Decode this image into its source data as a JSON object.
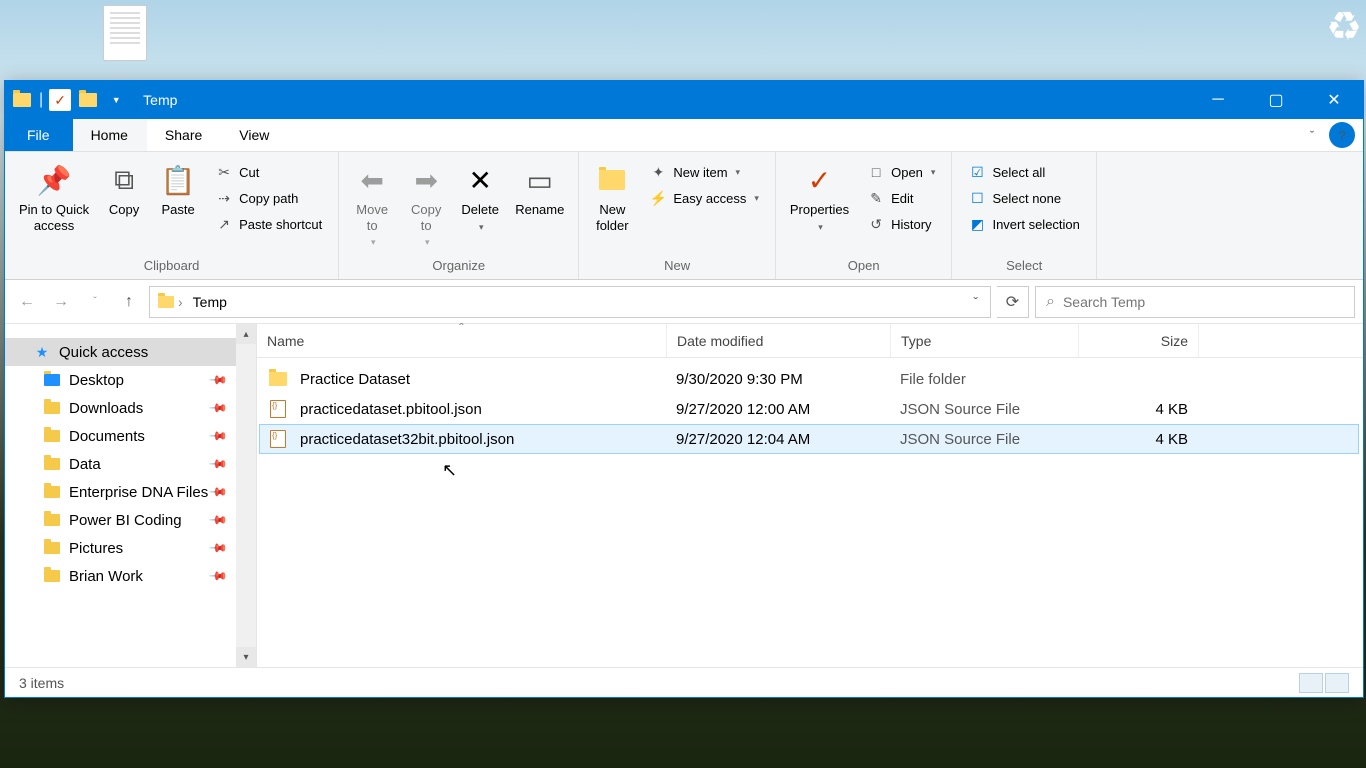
{
  "window": {
    "title": "Temp"
  },
  "tabs": {
    "file": "File",
    "home": "Home",
    "share": "Share",
    "view": "View"
  },
  "ribbon": {
    "clipboard": {
      "label": "Clipboard",
      "pin": "Pin to Quick\naccess",
      "copy": "Copy",
      "paste": "Paste",
      "cut": "Cut",
      "copy_path": "Copy path",
      "paste_shortcut": "Paste shortcut"
    },
    "organize": {
      "label": "Organize",
      "move_to": "Move\nto",
      "copy_to": "Copy\nto",
      "delete": "Delete",
      "rename": "Rename"
    },
    "new": {
      "label": "New",
      "new_folder": "New\nfolder",
      "new_item": "New item",
      "easy_access": "Easy access"
    },
    "open": {
      "label": "Open",
      "properties": "Properties",
      "open": "Open",
      "edit": "Edit",
      "history": "History"
    },
    "select": {
      "label": "Select",
      "select_all": "Select all",
      "select_none": "Select none",
      "invert": "Invert selection"
    }
  },
  "breadcrumb": {
    "current": "Temp"
  },
  "search": {
    "placeholder": "Search Temp"
  },
  "nav": {
    "quick": "Quick access",
    "items": [
      {
        "label": "Desktop",
        "color": "#1e90ff"
      },
      {
        "label": "Downloads",
        "color": "#f5c94a"
      },
      {
        "label": "Documents",
        "color": "#f5c94a"
      },
      {
        "label": "Data",
        "color": "#f5c94a"
      },
      {
        "label": "Enterprise DNA Files",
        "color": "#f5c94a"
      },
      {
        "label": "Power BI Coding",
        "color": "#f5c94a"
      },
      {
        "label": "Pictures",
        "color": "#f5c94a"
      },
      {
        "label": "Brian Work",
        "color": "#f5c94a"
      }
    ]
  },
  "columns": {
    "name": "Name",
    "date": "Date modified",
    "type": "Type",
    "size": "Size"
  },
  "files": [
    {
      "name": "Practice Dataset",
      "date": "9/30/2020 9:30 PM",
      "type": "File folder",
      "size": "",
      "kind": "folder"
    },
    {
      "name": "practicedataset.pbitool.json",
      "date": "9/27/2020 12:00 AM",
      "type": "JSON Source File",
      "size": "4 KB",
      "kind": "json"
    },
    {
      "name": "practicedataset32bit.pbitool.json",
      "date": "9/27/2020 12:04 AM",
      "type": "JSON Source File",
      "size": "4 KB",
      "kind": "json"
    }
  ],
  "status": {
    "count": "3 items"
  }
}
